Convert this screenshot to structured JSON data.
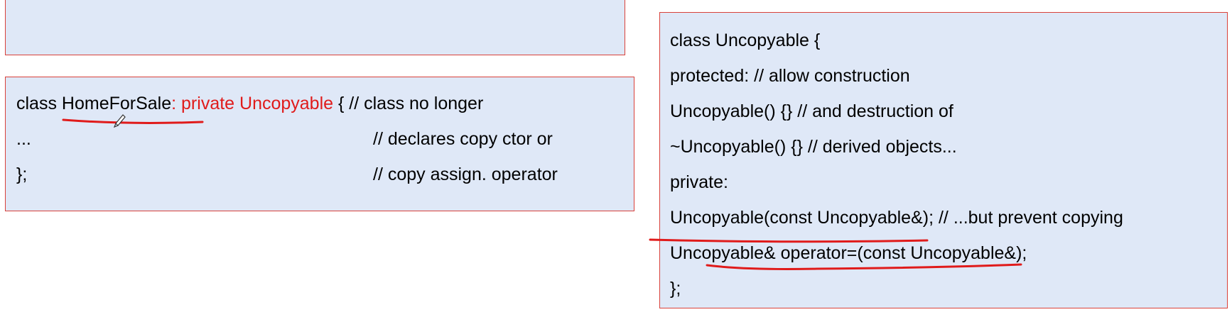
{
  "left_code": {
    "line1": {
      "keyword": "class ",
      "class_name": "HomeForSale",
      "inheritance": ": private Uncopyable",
      "rest": " { // class no longer"
    },
    "line2": {
      "code": "...",
      "comment": "// declares copy ctor or"
    },
    "line3": {
      "code": "};",
      "comment": "// copy assign. operator"
    }
  },
  "right_code": {
    "lines": [
      "class Uncopyable {",
      "protected: // allow construction",
      "Uncopyable() {} // and destruction of",
      "~Uncopyable() {} // derived objects...",
      "private:",
      "Uncopyable(const Uncopyable&); // ...but prevent copying",
      "Uncopyable& operator=(const Uncopyable&);",
      "};"
    ]
  },
  "colors": {
    "box_fill": "#dfe8f7",
    "box_border": "#d9413a",
    "highlight_text": "#e01b1b",
    "underline_ink": "#e01b1b"
  }
}
